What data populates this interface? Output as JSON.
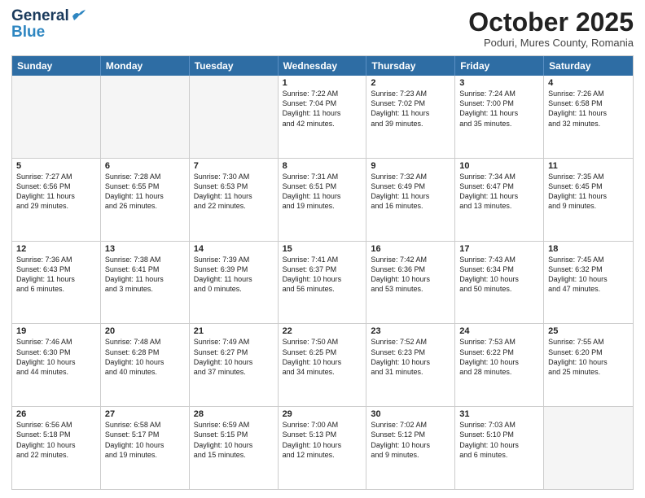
{
  "header": {
    "logo_general": "General",
    "logo_blue": "Blue",
    "month_title": "October 2025",
    "location": "Poduri, Mures County, Romania"
  },
  "days_of_week": [
    "Sunday",
    "Monday",
    "Tuesday",
    "Wednesday",
    "Thursday",
    "Friday",
    "Saturday"
  ],
  "weeks": [
    [
      {
        "day": "",
        "empty": true,
        "lines": []
      },
      {
        "day": "",
        "empty": true,
        "lines": []
      },
      {
        "day": "",
        "empty": true,
        "lines": []
      },
      {
        "day": "1",
        "empty": false,
        "lines": [
          "Sunrise: 7:22 AM",
          "Sunset: 7:04 PM",
          "Daylight: 11 hours",
          "and 42 minutes."
        ]
      },
      {
        "day": "2",
        "empty": false,
        "lines": [
          "Sunrise: 7:23 AM",
          "Sunset: 7:02 PM",
          "Daylight: 11 hours",
          "and 39 minutes."
        ]
      },
      {
        "day": "3",
        "empty": false,
        "lines": [
          "Sunrise: 7:24 AM",
          "Sunset: 7:00 PM",
          "Daylight: 11 hours",
          "and 35 minutes."
        ]
      },
      {
        "day": "4",
        "empty": false,
        "lines": [
          "Sunrise: 7:26 AM",
          "Sunset: 6:58 PM",
          "Daylight: 11 hours",
          "and 32 minutes."
        ]
      }
    ],
    [
      {
        "day": "5",
        "empty": false,
        "lines": [
          "Sunrise: 7:27 AM",
          "Sunset: 6:56 PM",
          "Daylight: 11 hours",
          "and 29 minutes."
        ]
      },
      {
        "day": "6",
        "empty": false,
        "lines": [
          "Sunrise: 7:28 AM",
          "Sunset: 6:55 PM",
          "Daylight: 11 hours",
          "and 26 minutes."
        ]
      },
      {
        "day": "7",
        "empty": false,
        "lines": [
          "Sunrise: 7:30 AM",
          "Sunset: 6:53 PM",
          "Daylight: 11 hours",
          "and 22 minutes."
        ]
      },
      {
        "day": "8",
        "empty": false,
        "lines": [
          "Sunrise: 7:31 AM",
          "Sunset: 6:51 PM",
          "Daylight: 11 hours",
          "and 19 minutes."
        ]
      },
      {
        "day": "9",
        "empty": false,
        "lines": [
          "Sunrise: 7:32 AM",
          "Sunset: 6:49 PM",
          "Daylight: 11 hours",
          "and 16 minutes."
        ]
      },
      {
        "day": "10",
        "empty": false,
        "lines": [
          "Sunrise: 7:34 AM",
          "Sunset: 6:47 PM",
          "Daylight: 11 hours",
          "and 13 minutes."
        ]
      },
      {
        "day": "11",
        "empty": false,
        "lines": [
          "Sunrise: 7:35 AM",
          "Sunset: 6:45 PM",
          "Daylight: 11 hours",
          "and 9 minutes."
        ]
      }
    ],
    [
      {
        "day": "12",
        "empty": false,
        "lines": [
          "Sunrise: 7:36 AM",
          "Sunset: 6:43 PM",
          "Daylight: 11 hours",
          "and 6 minutes."
        ]
      },
      {
        "day": "13",
        "empty": false,
        "lines": [
          "Sunrise: 7:38 AM",
          "Sunset: 6:41 PM",
          "Daylight: 11 hours",
          "and 3 minutes."
        ]
      },
      {
        "day": "14",
        "empty": false,
        "lines": [
          "Sunrise: 7:39 AM",
          "Sunset: 6:39 PM",
          "Daylight: 11 hours",
          "and 0 minutes."
        ]
      },
      {
        "day": "15",
        "empty": false,
        "lines": [
          "Sunrise: 7:41 AM",
          "Sunset: 6:37 PM",
          "Daylight: 10 hours",
          "and 56 minutes."
        ]
      },
      {
        "day": "16",
        "empty": false,
        "lines": [
          "Sunrise: 7:42 AM",
          "Sunset: 6:36 PM",
          "Daylight: 10 hours",
          "and 53 minutes."
        ]
      },
      {
        "day": "17",
        "empty": false,
        "lines": [
          "Sunrise: 7:43 AM",
          "Sunset: 6:34 PM",
          "Daylight: 10 hours",
          "and 50 minutes."
        ]
      },
      {
        "day": "18",
        "empty": false,
        "lines": [
          "Sunrise: 7:45 AM",
          "Sunset: 6:32 PM",
          "Daylight: 10 hours",
          "and 47 minutes."
        ]
      }
    ],
    [
      {
        "day": "19",
        "empty": false,
        "lines": [
          "Sunrise: 7:46 AM",
          "Sunset: 6:30 PM",
          "Daylight: 10 hours",
          "and 44 minutes."
        ]
      },
      {
        "day": "20",
        "empty": false,
        "lines": [
          "Sunrise: 7:48 AM",
          "Sunset: 6:28 PM",
          "Daylight: 10 hours",
          "and 40 minutes."
        ]
      },
      {
        "day": "21",
        "empty": false,
        "lines": [
          "Sunrise: 7:49 AM",
          "Sunset: 6:27 PM",
          "Daylight: 10 hours",
          "and 37 minutes."
        ]
      },
      {
        "day": "22",
        "empty": false,
        "lines": [
          "Sunrise: 7:50 AM",
          "Sunset: 6:25 PM",
          "Daylight: 10 hours",
          "and 34 minutes."
        ]
      },
      {
        "day": "23",
        "empty": false,
        "lines": [
          "Sunrise: 7:52 AM",
          "Sunset: 6:23 PM",
          "Daylight: 10 hours",
          "and 31 minutes."
        ]
      },
      {
        "day": "24",
        "empty": false,
        "lines": [
          "Sunrise: 7:53 AM",
          "Sunset: 6:22 PM",
          "Daylight: 10 hours",
          "and 28 minutes."
        ]
      },
      {
        "day": "25",
        "empty": false,
        "lines": [
          "Sunrise: 7:55 AM",
          "Sunset: 6:20 PM",
          "Daylight: 10 hours",
          "and 25 minutes."
        ]
      }
    ],
    [
      {
        "day": "26",
        "empty": false,
        "lines": [
          "Sunrise: 6:56 AM",
          "Sunset: 5:18 PM",
          "Daylight: 10 hours",
          "and 22 minutes."
        ]
      },
      {
        "day": "27",
        "empty": false,
        "lines": [
          "Sunrise: 6:58 AM",
          "Sunset: 5:17 PM",
          "Daylight: 10 hours",
          "and 19 minutes."
        ]
      },
      {
        "day": "28",
        "empty": false,
        "lines": [
          "Sunrise: 6:59 AM",
          "Sunset: 5:15 PM",
          "Daylight: 10 hours",
          "and 15 minutes."
        ]
      },
      {
        "day": "29",
        "empty": false,
        "lines": [
          "Sunrise: 7:00 AM",
          "Sunset: 5:13 PM",
          "Daylight: 10 hours",
          "and 12 minutes."
        ]
      },
      {
        "day": "30",
        "empty": false,
        "lines": [
          "Sunrise: 7:02 AM",
          "Sunset: 5:12 PM",
          "Daylight: 10 hours",
          "and 9 minutes."
        ]
      },
      {
        "day": "31",
        "empty": false,
        "lines": [
          "Sunrise: 7:03 AM",
          "Sunset: 5:10 PM",
          "Daylight: 10 hours",
          "and 6 minutes."
        ]
      },
      {
        "day": "",
        "empty": true,
        "lines": []
      }
    ]
  ]
}
